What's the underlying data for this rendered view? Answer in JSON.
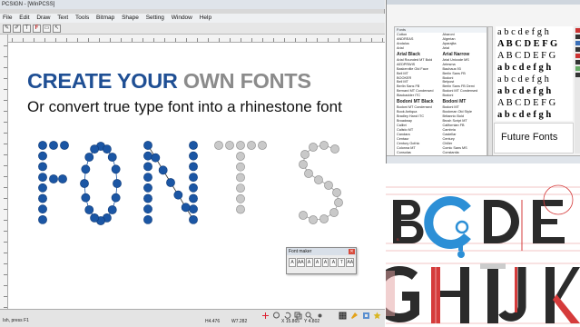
{
  "app": {
    "title": "PCSIGN - [WinPCSS]",
    "menu": [
      "File",
      "Edit",
      "Draw",
      "Text",
      "Tools",
      "Bitmap",
      "Shape",
      "Setting",
      "Window",
      "Help"
    ],
    "toolbar_icons": [
      "pen-icon",
      "pencil-icon",
      "text-icon",
      "font-icon",
      "select-icon",
      "arrow-icon"
    ],
    "headline": {
      "blue": "CREATE YOUR",
      "grey": "OWN FONTS"
    },
    "subline": "Or convert true type font into a rhinestone font",
    "rhinestone_word": "FONTS",
    "colors": {
      "blue_stone": "#1b56a4",
      "grey_stone": "#c9c9c9",
      "headline_blue": "#1f4f94"
    },
    "font_maker": {
      "title": "Font maker",
      "buttons": [
        "A",
        "AA",
        "A",
        "A",
        "A",
        "A",
        "T",
        "AA"
      ]
    },
    "status": {
      "left": "Ish, press F1",
      "h": "H4.476",
      "w": "W7.282",
      "x": "X 15.865",
      "y": "Y 4.802"
    }
  },
  "font_panel": {
    "header": "Fonts",
    "fonts": [
      [
        "Cotton",
        "Aharoni"
      ],
      [
        "ANDREAS",
        "Algerian"
      ],
      [
        "Andalus",
        "Aparajita"
      ],
      [
        "Arial",
        "Arial"
      ],
      [
        "Arial Black",
        "Arial Narrow"
      ],
      [
        "Arial Rounded MT Bold",
        "Arial Unicode MS"
      ],
      [
        "AEDPRWIS",
        "Artesma"
      ],
      [
        "Baskerville Old Face",
        "Bauhaus 93"
      ],
      [
        "Bell MT",
        "Berlin Sans FB"
      ],
      [
        "BOOKER",
        "Bodoni"
      ],
      [
        "Bell MT",
        "Belpost"
      ],
      [
        "Berlin Sans FB",
        "Berlin Sans FB Demi"
      ],
      [
        "Bernard MT Condensed",
        "Bodoni MT Condensed"
      ],
      [
        "Blackadder ITC",
        "Bodoni"
      ],
      [
        "Bodoni MT Black",
        "Bodoni MT"
      ],
      [
        "Bodoni MT Condensed",
        "Bodoni MT"
      ],
      [
        "Book Antiqua",
        "Bookman Old Style"
      ],
      [
        "Bradley Hand ITC",
        "Britannic Bold"
      ],
      [
        "Broadway",
        "Brush Script MT"
      ],
      [
        "Calibri",
        "Californian FB"
      ],
      [
        "Calisto MT",
        "Cambria"
      ],
      [
        "Candara",
        "Castellar"
      ],
      [
        "Centaur",
        "Century"
      ],
      [
        "Century Gothic",
        "Chiller"
      ],
      [
        "Colonna MT",
        "Comic Sans MS"
      ],
      [
        "Consolas",
        "Constantia"
      ],
      [
        "Cooper Black",
        "Copperplate Gothic"
      ],
      [
        "Corbel",
        "Courier New"
      ],
      [
        "Curlz MT",
        "Edwardian Script"
      ]
    ],
    "glyph_rows": [
      "a b c d e f g h",
      "A B C D E F G",
      "A B C D E F G",
      "a b c d e f g h",
      "a b c d e f g h",
      "a b c d e f g h",
      "A B C D E F G",
      "a b c d e f g h"
    ],
    "sample_text": "Future Fonts"
  },
  "letter_art": {
    "top_row": [
      "B",
      "C",
      "D",
      "E"
    ],
    "bottom_row": [
      "G",
      "H",
      "I",
      "J",
      "K"
    ],
    "colors": {
      "black": "#2b2b2b",
      "blue": "#2c8fd6",
      "red": "#d53b3b"
    }
  }
}
